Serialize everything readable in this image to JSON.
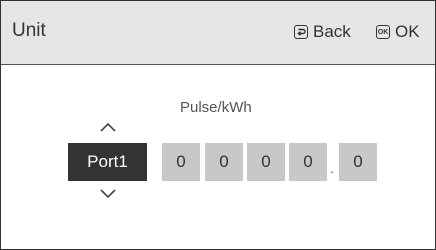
{
  "header": {
    "title": "Unit",
    "back_label": "Back",
    "ok_label": "OK",
    "ok_icon_text": "OK"
  },
  "field": {
    "label": "Pulse/kWh"
  },
  "port": {
    "label": "Port1"
  },
  "digits": [
    "0",
    "0",
    "0",
    "0",
    "0"
  ],
  "decimal_separator": ".",
  "icons": {
    "back": "back-arrow-icon",
    "ok": "ok-key-icon",
    "up": "chevron-up-icon",
    "down": "chevron-down-icon"
  }
}
